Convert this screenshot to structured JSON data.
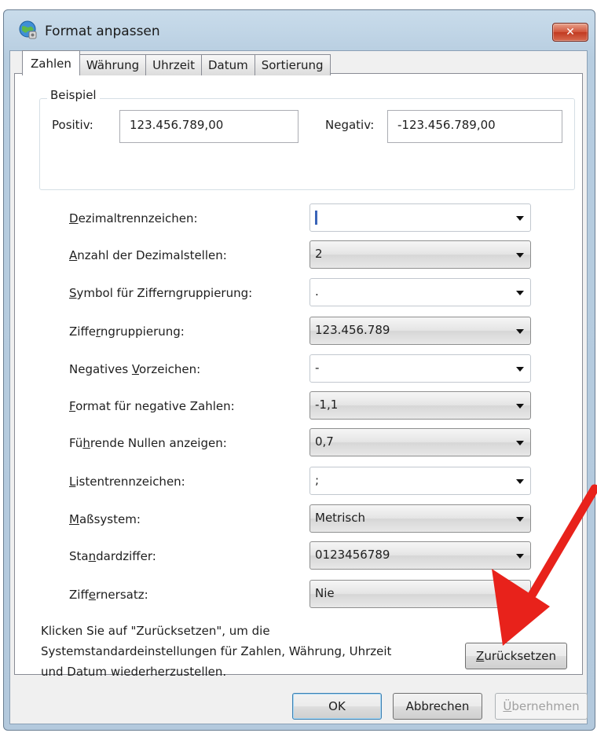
{
  "window": {
    "title": "Format anpassen",
    "close_label": "✕"
  },
  "tabs": [
    {
      "label": "Zahlen",
      "active": true
    },
    {
      "label": "Währung"
    },
    {
      "label": "Uhrzeit"
    },
    {
      "label": "Datum"
    },
    {
      "label": "Sortierung"
    }
  ],
  "example": {
    "legend": "Beispiel",
    "positive_label": "Positiv:",
    "positive_value": "123.456.789,00",
    "negative_label": "Negativ:",
    "negative_value": "-123.456.789,00"
  },
  "settings": [
    {
      "pre": "",
      "key": "D",
      "post": "ezimaltrennzeichen:",
      "value": ",",
      "style": "editable",
      "caret": true
    },
    {
      "pre": "",
      "key": "A",
      "post": "nzahl der Dezimalstellen:",
      "value": "2",
      "style": "readonly"
    },
    {
      "pre": "",
      "key": "S",
      "post": "ymbol für Zifferngruppierung:",
      "value": ".",
      "style": "editable"
    },
    {
      "pre": "Ziffe",
      "key": "r",
      "post": "ngruppierung:",
      "value": "123.456.789",
      "style": "readonly"
    },
    {
      "pre": "Negatives ",
      "key": "V",
      "post": "orzeichen:",
      "value": "-",
      "style": "editable"
    },
    {
      "pre": "",
      "key": "F",
      "post": "ormat für negative Zahlen:",
      "value": "-1,1",
      "style": "readonly"
    },
    {
      "pre": "Fü",
      "key": "h",
      "post": "rende Nullen anzeigen:",
      "value": "0,7",
      "style": "readonly"
    },
    {
      "pre": "",
      "key": "L",
      "post": "istentrennzeichen:",
      "value": ";",
      "style": "editable"
    },
    {
      "pre": "",
      "key": "M",
      "post": "aßsystem:",
      "value": "Metrisch",
      "style": "readonly"
    },
    {
      "pre": "Sta",
      "key": "n",
      "post": "dardziffer:",
      "value": "0123456789",
      "style": "readonly"
    },
    {
      "pre": "Ziff",
      "key": "e",
      "post": "rnersatz:",
      "value": "Nie",
      "style": "readonly"
    }
  ],
  "footnote": {
    "line1": "Klicken Sie auf \"Zurücksetzen\", um die",
    "line2": "Systemstandardeinstellungen für Zahlen, Währung, Uhrzeit",
    "line3": "und Datum wiederherzustellen."
  },
  "buttons": {
    "reset_key": "Z",
    "reset_rest": "urücksetzen",
    "ok": "OK",
    "cancel": "Abbrechen",
    "apply_key": "Ü",
    "apply_rest": "bernehmen"
  },
  "colors": {
    "annotation_arrow": "#e8221b",
    "focus_blue": "#3c7fb1"
  }
}
